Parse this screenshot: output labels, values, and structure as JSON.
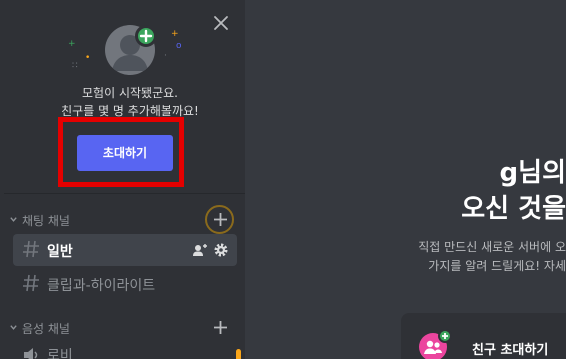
{
  "colors": {
    "sidebar_bg": "#2f3136",
    "main_bg": "#36393f",
    "blurple": "#5865f2",
    "green": "#3ba55d",
    "highlight_red": "#e50000",
    "pink": "#eb459e"
  },
  "onboarding": {
    "welcome_line1": "모험이 시작됐군요.",
    "welcome_line2": "친구를 몇 명 추가해볼까요!",
    "invite_button": "초대하기"
  },
  "sidebar": {
    "categories": [
      {
        "label": "채팅 채널",
        "channels": [
          {
            "name": "일반",
            "active": true
          },
          {
            "name": "클립과-하이라이트",
            "active": false
          }
        ]
      },
      {
        "label": "음성 채널",
        "channels": [
          {
            "name": "로비",
            "active": false
          }
        ]
      }
    ]
  },
  "main": {
    "headline_line1": "g님의",
    "headline_line2": "오신 것을",
    "sub_line1": "직접 만드신 새로운 서버에 오",
    "sub_line2": "가지를 알려    드릴게요! 자세",
    "action_card_label": "친구 초대하기"
  }
}
